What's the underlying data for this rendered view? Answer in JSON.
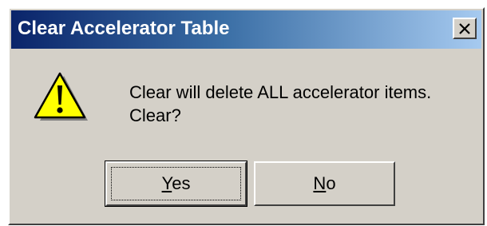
{
  "dialog": {
    "title": "Clear Accelerator Table",
    "message_line1": "Clear will delete ALL accelerator items.",
    "message_line2": "Clear?",
    "icon": "warning-icon"
  },
  "buttons": {
    "yes_mnemonic": "Y",
    "yes_rest": "es",
    "no_mnemonic": "N",
    "no_rest": "o"
  },
  "titlebar": {
    "close_icon": "close-icon"
  },
  "colors": {
    "dialog_background": "#d4d0c8",
    "title_gradient_start": "#0a246a",
    "title_gradient_end": "#a6caf0",
    "warning_fill": "#ffff00"
  }
}
